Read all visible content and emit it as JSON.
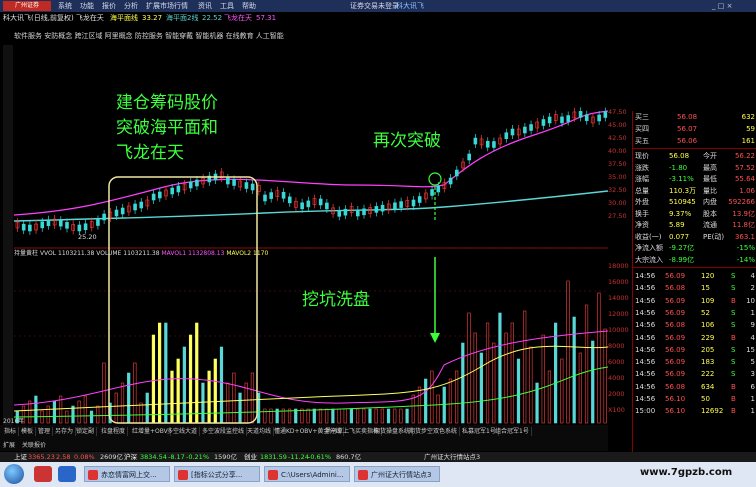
{
  "menubar": {
    "logo": "广州证券",
    "items": [
      "系统",
      "功能",
      "报价",
      "分析",
      "扩展市场行情",
      "资讯",
      "工具",
      "帮助"
    ],
    "app": "证券交易未登录",
    "brand": "科大讯飞"
  },
  "titlebar": {
    "stock": "科大讯飞(日线,前复权) 飞龙在天",
    "ind1": "海平面线",
    "ind1_val": "33.27",
    "ind2": "海平面2线",
    "ind2_val": "22.52",
    "ind3": "飞龙在天",
    "ind3_val": "57.31"
  },
  "services": "软件服务 安防概念 跨江区域 阿里概念 防控服务 智能穿戴 智能机器 在线教育 人工智能",
  "volume_header": {
    "name": "持量黄柱",
    "vvol_label": "VVOL",
    "vvol_val": "1103211.38",
    "volume_label": "VOLUME",
    "volume_val": "1103211.38",
    "mavol1_label": "MAVOL1",
    "mavol1_val": "1132808.13",
    "mavol2_label": "MAVOL2",
    "mavol2_val": "1170"
  },
  "price_low_label": "25.20",
  "date_label": "2016年",
  "price_scale": [
    "47.50",
    "45.00",
    "42.50",
    "40.00",
    "37.50",
    "35.00",
    "32.50",
    "30.00",
    "27.50",
    "25.00"
  ],
  "vol_scale": [
    "18000",
    "16000",
    "14000",
    "12000",
    "10000",
    "8000",
    "6000",
    "4000",
    "2000",
    "X100"
  ],
  "annotations": {
    "a1": "建仓筹码股价",
    "a2": "突破海平面和",
    "a3": "飞龙在天",
    "a4": "再次突破",
    "a5": "挖坑洗盘"
  },
  "orderbook": [
    {
      "label": "买三",
      "price": "56.08",
      "vol": "632"
    },
    {
      "label": "买四",
      "price": "56.07",
      "vol": "59"
    },
    {
      "label": "买五",
      "price": "56.06",
      "vol": "161"
    }
  ],
  "quote": [
    {
      "l1": "现价",
      "v1": "56.08",
      "l2": "今开",
      "v2": "56.22"
    },
    {
      "l1": "涨跌",
      "v1": "-1.80",
      "l2": "最高",
      "v2": "57.52"
    },
    {
      "l1": "涨幅",
      "v1": "-3.11%",
      "l2": "最低",
      "v2": "55.64"
    },
    {
      "l1": "总量",
      "v1": "110.3万",
      "l2": "量比",
      "v2": "1.06"
    },
    {
      "l1": "外盘",
      "v1": "510945",
      "l2": "内盘",
      "v2": "592266"
    },
    {
      "l1": "换手",
      "v1": "9.37%",
      "l2": "股本",
      "v2": "13.9亿"
    },
    {
      "l1": "净资",
      "v1": "5.89",
      "l2": "流通",
      "v2": "11.8亿"
    },
    {
      "l1": "收益(一)",
      "v1": "0.077",
      "l2": "PE(动)",
      "v2": "363.1"
    },
    {
      "l1": "净流入额",
      "v1": "-9.27亿",
      "l2": "",
      "v2": "-15%"
    },
    {
      "l1": "大宗流入",
      "v1": "-8.99亿",
      "l2": "",
      "v2": "-14%"
    }
  ],
  "ticks": [
    [
      "14:56",
      "56.09",
      "120",
      "S",
      "4"
    ],
    [
      "14:56",
      "56.08",
      "15",
      "S",
      "2"
    ],
    [
      "14:56",
      "56.09",
      "109",
      "B",
      "10"
    ],
    [
      "14:56",
      "56.09",
      "52",
      "S",
      "1"
    ],
    [
      "14:56",
      "56.08",
      "106",
      "S",
      "9"
    ],
    [
      "14:56",
      "56.09",
      "229",
      "B",
      "4"
    ],
    [
      "14:56",
      "56.09",
      "205",
      "S",
      "15"
    ],
    [
      "14:56",
      "56.09",
      "183",
      "S",
      "5"
    ],
    [
      "14:56",
      "56.09",
      "222",
      "S",
      "3"
    ],
    [
      "14:56",
      "56.08",
      "634",
      "B",
      "6"
    ],
    [
      "14:56",
      "56.10",
      "50",
      "B",
      "1"
    ],
    [
      "15:00",
      "56.10",
      "12692",
      "B",
      "1"
    ]
  ],
  "tabs": [
    "指标",
    "模板",
    "管理",
    "另存为",
    "锁定副",
    "拉盘程度",
    "红增量+OBV",
    "多空线大道",
    "多空波段监控线",
    "天道均线",
    "懂通KD+OBV+黄金分线",
    "黑马草上飞买卖指标",
    "期货操盘系统",
    "期货步空双色系统",
    "私募冠军1号",
    "组合冠军1号"
  ],
  "tabs2": [
    "扩展",
    "关联报价"
  ],
  "statusbar": {
    "sh_label": "上证",
    "sh_val": "3365.23",
    "sh_chg": "2.58",
    "sh_pct": "0.08%",
    "sh_amt": "2609亿",
    "sz_label": "沪深",
    "sz_val": "3834.54",
    "sz_chg": "-8.17",
    "sz_pct": "-0.21%",
    "sz_amt": "1590亿",
    "cy_label": "创业",
    "cy_val": "1831.59",
    "cy_chg": "-11.24",
    "cy_pct": "-0.61%",
    "cy_amt": "860.7亿",
    "broker": "广州证大行情站点3"
  },
  "taskbar": {
    "items": [
      "赤恋情富网上交...",
      "[指标公式分享...",
      "C:\\Users\\Admini...",
      "广州证大行情站点3"
    ],
    "watermark": "www.7gpzb.com"
  }
}
